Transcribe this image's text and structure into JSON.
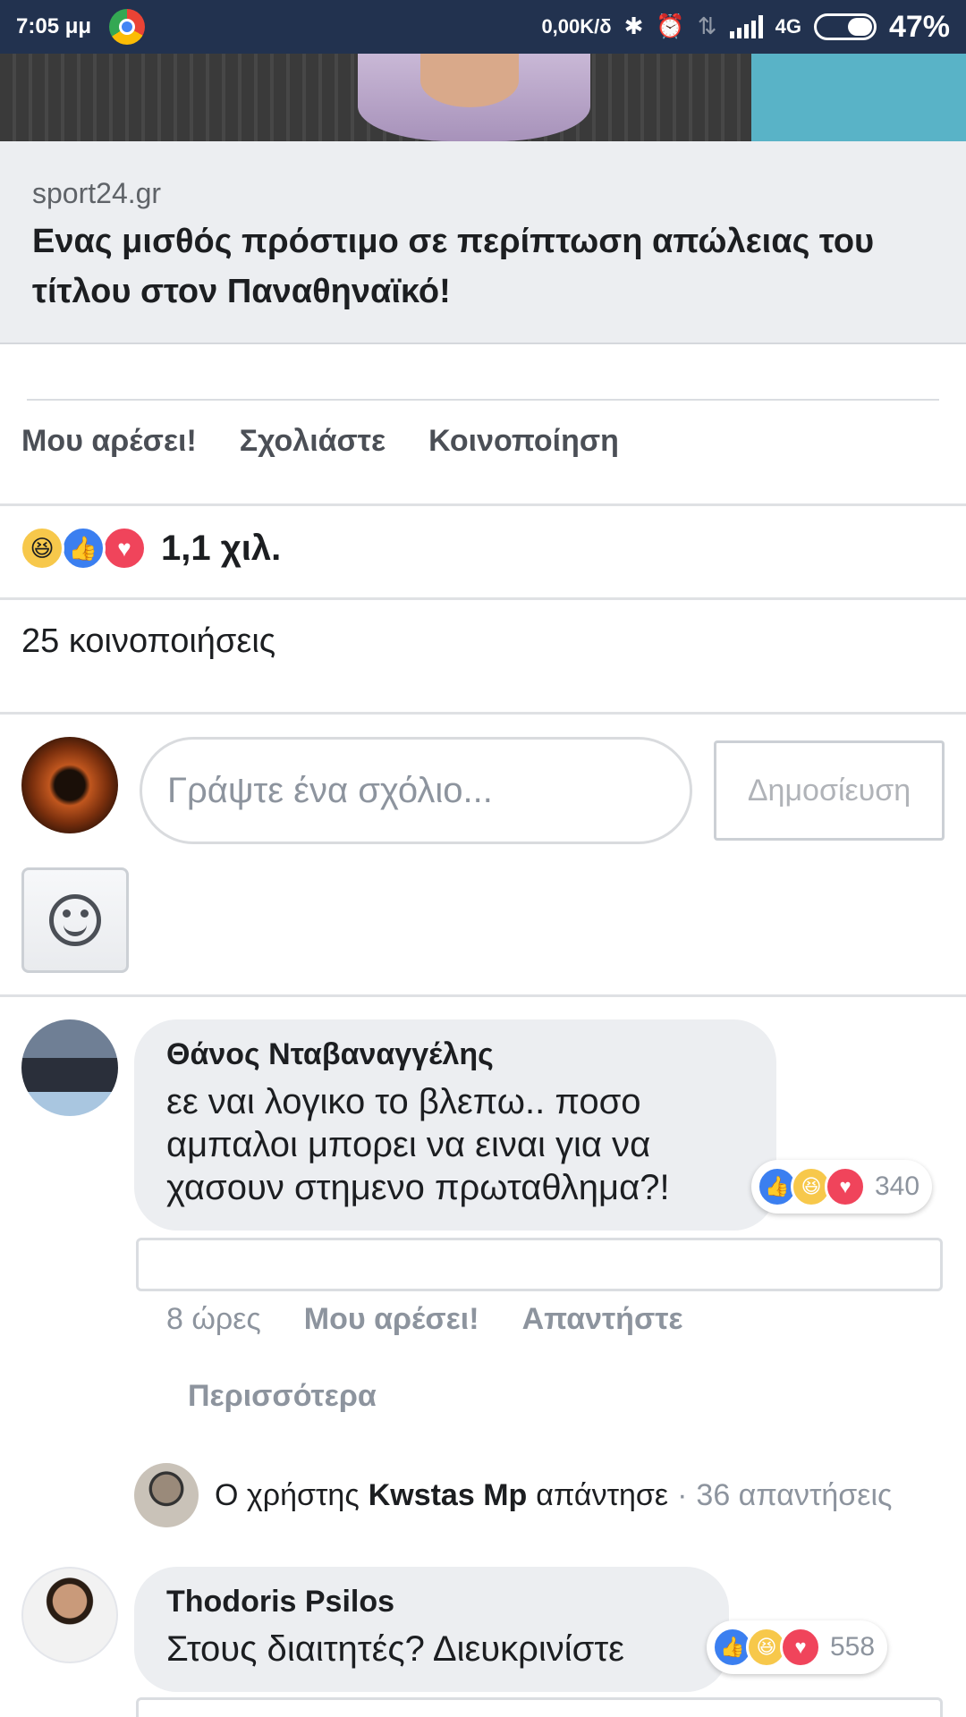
{
  "status_bar": {
    "time": "7:05 μμ",
    "speed": "0,00K/δ",
    "network": "4G",
    "battery_percent": "47%",
    "battery_level": 0.47
  },
  "preview": {
    "domain": "sport24.gr",
    "title": "Ενας μισθός πρόστιμο σε περίπτωση απώλειας του τίτλου στον Παναθηναϊκό!"
  },
  "actions": {
    "like": "Μου αρέσει!",
    "comment": "Σχολιάστε",
    "share": "Κοινοποίηση"
  },
  "reactions": {
    "count": "1,1 χιλ.",
    "types": [
      "haha",
      "like",
      "love"
    ]
  },
  "shares": "25 κοινοποιήσεις",
  "composer": {
    "placeholder": "Γράψτε ένα σχόλιο...",
    "post_label": "Δημοσίευση"
  },
  "comments": [
    {
      "author": "Θάνος Νταβαναγγέλης",
      "text": "εε ναι λογικο το βλεπω.. ποσο αμπαλοι μπορει να ειναι για να χασουν στημενο πρωταθλημα?!",
      "reactions_count": "340",
      "time": "8 ώρες",
      "like_label": "Μου αρέσει!",
      "reply_label": "Απαντήστε",
      "more_label": "Περισσότερα",
      "reply_summary": {
        "prefix": "Ο χρήστης",
        "name": "Kwstas Mp",
        "verb": "απάντησε",
        "separator": "·",
        "count": "36 απαντήσεις"
      }
    },
    {
      "author": "Thodoris Psilos",
      "text": "Στους διαιτητές? Διευκρινίστε",
      "reactions_count": "558"
    }
  ],
  "colors": {
    "status_bar": "#22324f",
    "like_blue": "#3b7ff0",
    "love_red": "#f0445b",
    "haha_yellow": "#f7c84b",
    "bubble_gray": "#eceef1"
  }
}
